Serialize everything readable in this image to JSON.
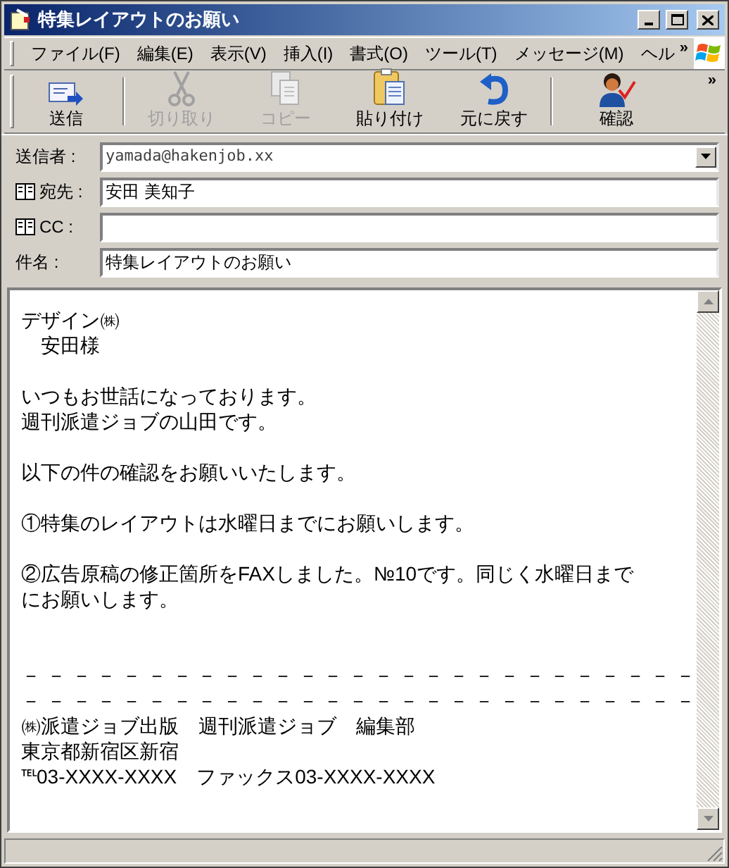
{
  "window": {
    "title": "特集レイアウトのお願い"
  },
  "menu": [
    {
      "label": "ファイル(F)"
    },
    {
      "label": "編集(E)"
    },
    {
      "label": "表示(V)"
    },
    {
      "label": "挿入(I)"
    },
    {
      "label": "書式(O)"
    },
    {
      "label": "ツール(T)"
    },
    {
      "label": "メッセージ(M)"
    },
    {
      "label": "ヘル"
    }
  ],
  "menu_overflow": "»",
  "toolbar": [
    {
      "label": "送信",
      "kind": "send",
      "disabled": false
    },
    {
      "label": "切り取り",
      "kind": "cut",
      "disabled": true
    },
    {
      "label": "コピー",
      "kind": "copy",
      "disabled": true
    },
    {
      "label": "貼り付け",
      "kind": "paste",
      "disabled": false
    },
    {
      "label": "元に戻す",
      "kind": "undo",
      "disabled": false
    },
    {
      "label": "確認",
      "kind": "check",
      "disabled": false
    }
  ],
  "toolbar_overflow": "»",
  "fields": [
    {
      "label": "送信者 :",
      "kind": "dropdown",
      "value": "yamada@hakenjob.xx"
    },
    {
      "label": "宛先 :",
      "kind": "address",
      "value": "安田 美知子"
    },
    {
      "label": "CC :",
      "kind": "address"
    },
    {
      "label": "件名 :",
      "kind": "text",
      "value": "特集レイアウトのお願い"
    }
  ],
  "body": [
    {
      "kind": "text",
      "text": "デザイン㈱"
    },
    {
      "kind": "text",
      "text": "　安田様"
    },
    {
      "kind": "blank"
    },
    {
      "kind": "text",
      "text": "いつもお世話になっております。"
    },
    {
      "kind": "text",
      "text": "週刊派遣ジョブの山田です。"
    },
    {
      "kind": "blank"
    },
    {
      "kind": "text",
      "text": "以下の件の確認をお願いいたします。"
    },
    {
      "kind": "blank"
    },
    {
      "kind": "text",
      "text": "①特集のレイアウトは水曜日までにお願いします。"
    },
    {
      "kind": "blank"
    },
    {
      "kind": "text",
      "text": "②広告原稿の修正箇所をFAXしました。№10です。同じく水曜日まで"
    },
    {
      "kind": "text",
      "text": "にお願いします。"
    },
    {
      "kind": "blank"
    },
    {
      "kind": "blank"
    },
    {
      "kind": "text",
      "text": "－ － － － － － － － － － － － － － － － － － － － － － － － － － －"
    },
    {
      "kind": "text",
      "text": "－ － － － － － － － － － － － － － － － － － － － － － － － － － －"
    },
    {
      "kind": "text",
      "text": "㈱派遣ジョブ出版　週刊派遣ジョブ　編集部"
    },
    {
      "kind": "text",
      "text": "東京都新宿区新宿"
    },
    {
      "kind": "text",
      "text": "℡03-XXXX-XXXX　ファックス03-XXXX-XXXX"
    }
  ]
}
